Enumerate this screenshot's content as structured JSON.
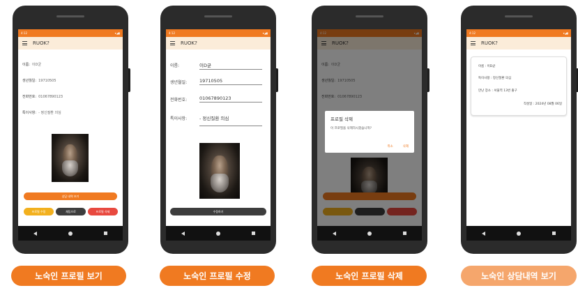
{
  "colors": {
    "accent": "#f07a21",
    "accent_light": "#f5a66c",
    "appbar_bg": "#fbecd9",
    "btn_yellow": "#f2b01e",
    "btn_dark": "#3d3d3d",
    "btn_red": "#e8493f",
    "btn_orange": "#f07a21"
  },
  "status": {
    "time": "4:12",
    "right": "▾◢▮"
  },
  "app_title": "RUOK?",
  "icons": [
    "menu-icon",
    "back-icon",
    "home-icon",
    "recents-icon"
  ],
  "screens": {
    "view": {
      "labels": {
        "name": "이름:",
        "birth": "생년월일:",
        "phone": "전화번호:",
        "note": "특이사항:"
      },
      "values": {
        "name": "이D균",
        "birth": "19710505",
        "phone": "01067890123",
        "note": "- 정신질환 의심"
      },
      "buttons": {
        "consult": "상담 내역 보기",
        "edit": "프로필 수정",
        "chat": "채팅으로",
        "delete": "프로필 삭제"
      }
    },
    "edit": {
      "labels": {
        "name": "이름:",
        "birth": "생년월일:",
        "phone": "전화번호:",
        "note": "특이사항:"
      },
      "values": {
        "name": "이D균",
        "birth": "19710505",
        "phone": "01067890123",
        "note": "- 정신질환 의심"
      },
      "buttons": {
        "save": "수정하기"
      }
    },
    "delete": {
      "labels": {
        "name": "이름:",
        "birth": "생년월일:",
        "phone": "전화번호:",
        "note": "특이사항:"
      },
      "values": {
        "name": "이D균",
        "birth": "19710505",
        "phone": "01067890123",
        "note": "- 정신질환 의심"
      },
      "dialog": {
        "title": "프로필 삭제",
        "message": "이 프로필을 삭제하시겠습니까?",
        "cancel": "취소",
        "confirm": "삭제"
      }
    },
    "history": {
      "lines": [
        "이름 : 이D균",
        "특이사항 : 정신질환 의심",
        "만난 장소 : 서울역 13번 출구"
      ],
      "date": "작성일 : 2024년 08월 06일"
    }
  },
  "captions": [
    "노숙인 프로필 보기",
    "노숙인 프로필 수정",
    "노숙인 프로필 삭제",
    "노숙인 상담내역 보기"
  ]
}
